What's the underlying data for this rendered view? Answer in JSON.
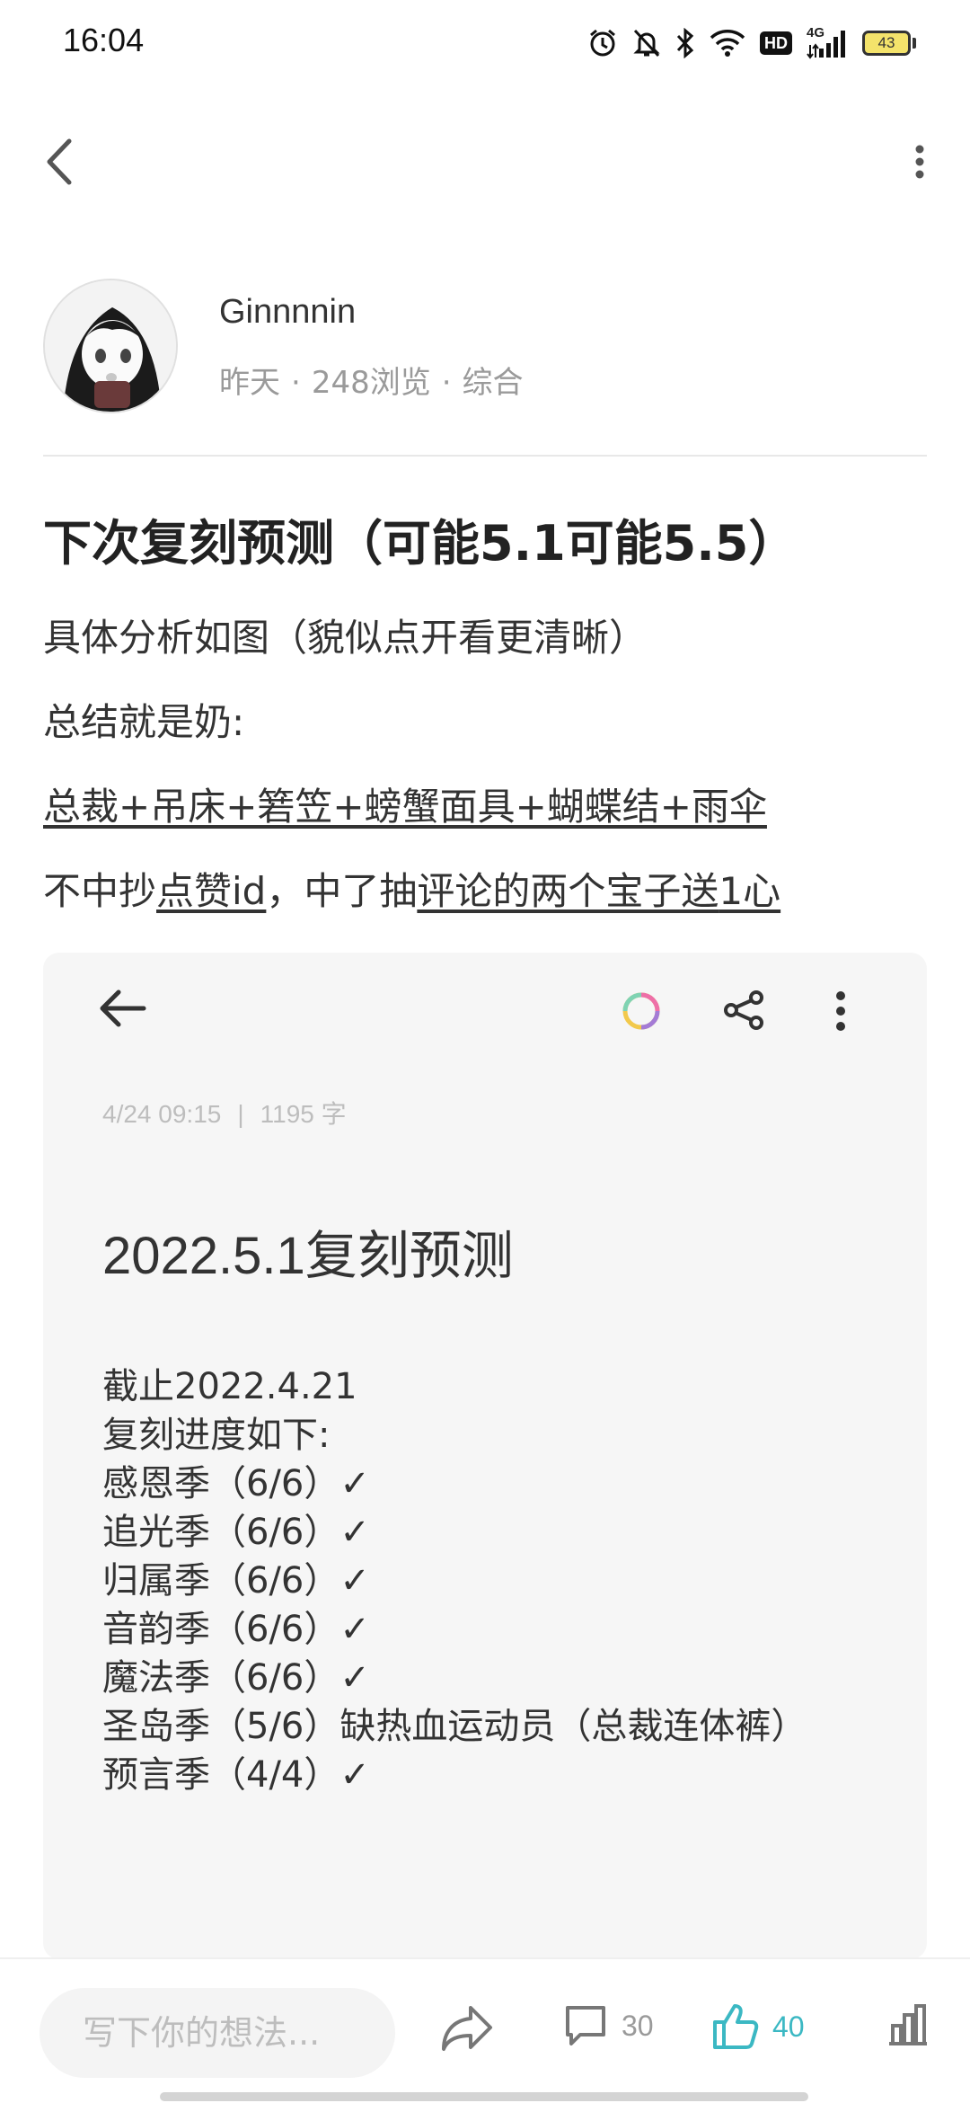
{
  "status_bar": {
    "time": "16:04",
    "hd_label": "HD",
    "network_label": "4G",
    "battery_level": "43"
  },
  "author": {
    "name": "Ginnnnin",
    "time": "昨天",
    "views": "248浏览",
    "category": "综合",
    "separator": "·"
  },
  "post": {
    "title": "下次复刻预测（可能5.1可能5.5）",
    "line1": "具体分析如图（貌似点开看更清晰）",
    "line2": "总结就是奶:",
    "line3": "总裁+吊床+箬笠+螃蟹面具+蝴蝶结+雨伞",
    "line4_a": "不中抄",
    "line4_b": "点赞id",
    "line4_c": "，中了抽",
    "line4_d": "评论的两个宝子送",
    "line4_e": "1心"
  },
  "screenshot": {
    "date": "4/24 09:15",
    "sep": "|",
    "word_count": "1195 字",
    "title": "2022.5.1复刻预测",
    "lines": [
      "截止2022.4.21",
      "复刻进度如下:",
      "感恩季（6/6）✓",
      "追光季（6/6）✓",
      "归属季（6/6）✓",
      "音韵季（6/6）✓",
      "魔法季（6/6）✓",
      "圣岛季（5/6）缺热血运动员（总裁连体裤）",
      "预言季（4/4）✓"
    ]
  },
  "bottom_bar": {
    "comment_placeholder": "写下你的想法...",
    "comment_count": "30",
    "like_count": "40",
    "accent_color": "#3bb8c3"
  }
}
